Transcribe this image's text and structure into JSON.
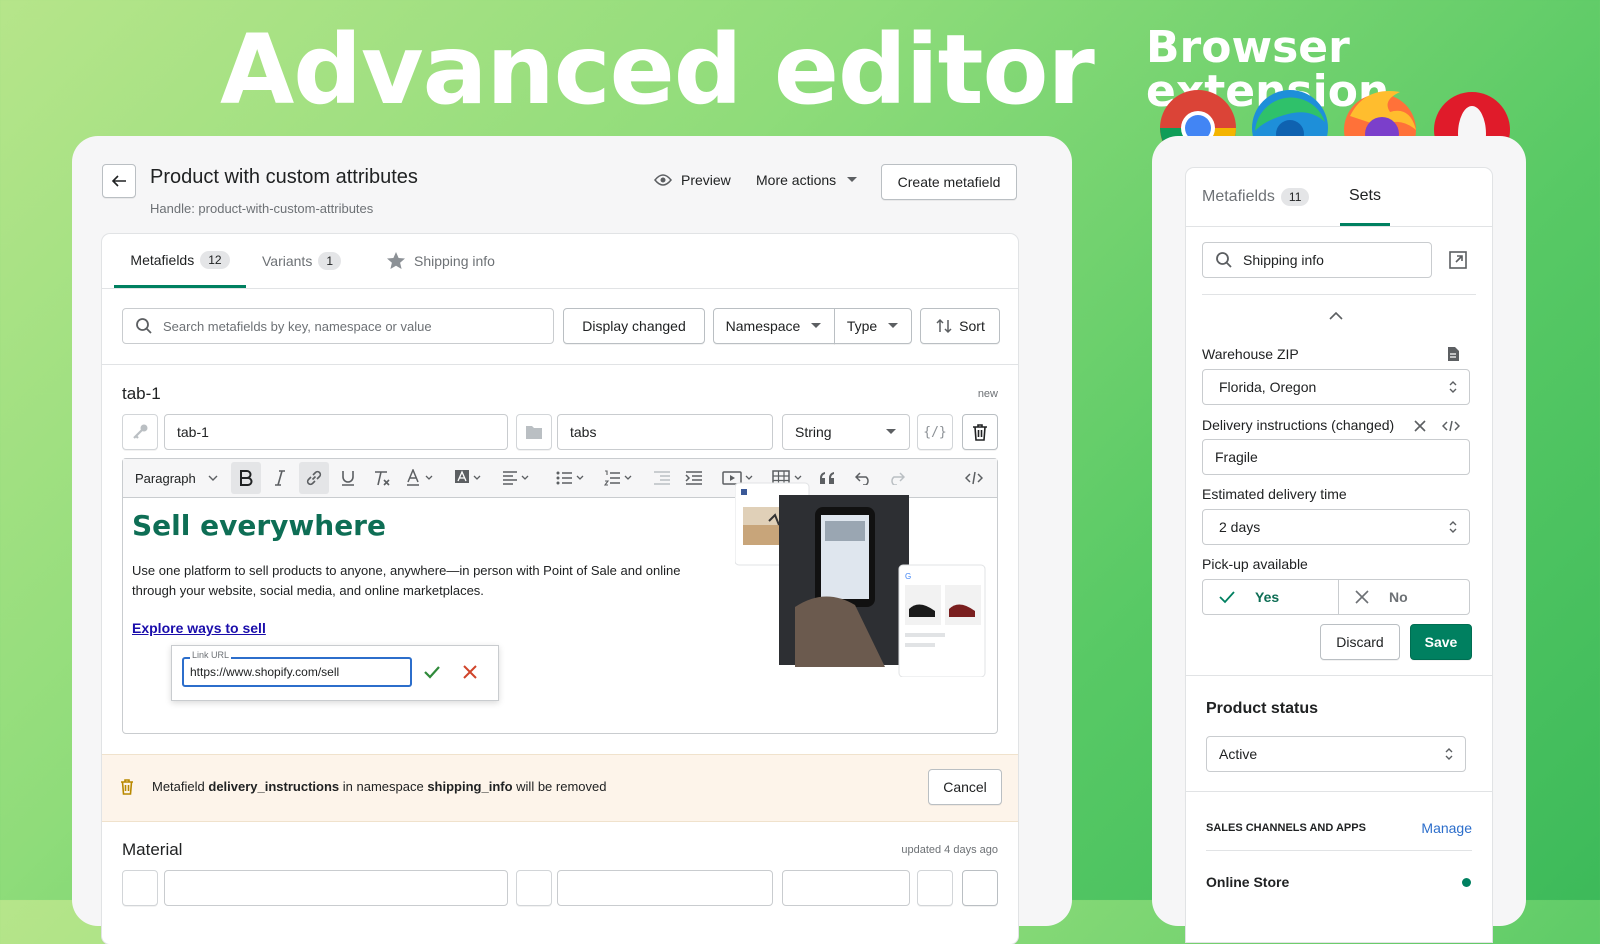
{
  "hero": {
    "title": "Advanced editor",
    "subtitle": "Browser extension"
  },
  "header": {
    "title": "Product with custom attributes",
    "handle": "Handle: product-with-custom-attributes",
    "preview": "Preview",
    "more_actions": "More actions",
    "create": "Create metafield"
  },
  "tabs": [
    {
      "label": "Metafields",
      "count": "12"
    },
    {
      "label": "Variants",
      "count": "1"
    },
    {
      "label": "Shipping info"
    }
  ],
  "filters": {
    "search_placeholder": "Search metafields by key, namespace or value",
    "display_changed": "Display changed",
    "namespace": "Namespace",
    "type": "Type",
    "sort": "Sort"
  },
  "metafield1": {
    "title": "tab-1",
    "status": "new",
    "key": "tab-1",
    "namespace": "tabs",
    "type": "String",
    "code_btn": "{/}"
  },
  "toolbar": {
    "paragraph": "Paragraph"
  },
  "content": {
    "heading": "Sell everywhere",
    "body": "Use one platform to sell products to anyone, anywhere—in person with Point of Sale and online through your website, social media, and online marketplaces.",
    "link": "Explore ways to sell",
    "link_label": "Link URL",
    "link_url": "https://www.shopify.com/sell"
  },
  "warning": {
    "prefix": "Metafield ",
    "key": "delivery_instructions",
    "mid": " in namespace ",
    "ns": "shipping_info",
    "suffix": " will be removed",
    "cancel": "Cancel"
  },
  "metafield2": {
    "title": "Material",
    "status": "updated 4 days ago"
  },
  "side": {
    "tab_metafields": "Metafields",
    "tab_count": "11",
    "tab_sets": "Sets",
    "search_value": "Shipping info",
    "fields": [
      {
        "label": "Warehouse ZIP",
        "value": "Florida, Oregon"
      },
      {
        "label": "Delivery instructions (changed)",
        "value": "Fragile"
      },
      {
        "label": "Estimated delivery time",
        "value": "2 days"
      },
      {
        "label": "Pick-up available",
        "yes": "Yes",
        "no": "No"
      }
    ],
    "discard": "Discard",
    "save": "Save",
    "status_title": "Product status",
    "status_value": "Active",
    "channels_title": "SALES CHANNELS AND APPS",
    "manage": "Manage",
    "online_store": "Online Store"
  },
  "colors": {
    "accent": "#008060",
    "heading_green": "#0e6e55",
    "warning_bg": "#fdf4ea"
  }
}
